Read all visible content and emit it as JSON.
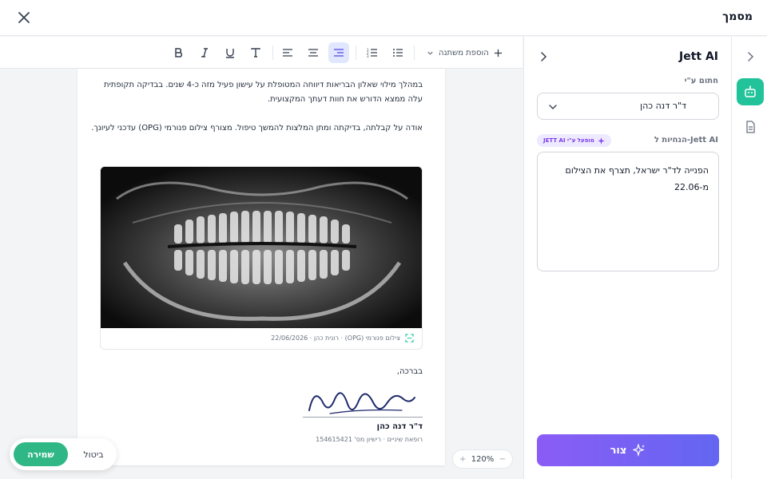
{
  "header": {
    "title": "מסמך"
  },
  "toolbar": {
    "add_variable_label": "הוספת משתנה"
  },
  "document": {
    "paragraph_1": "במהלך מילוי שאלון הבריאות דיווחה המטופלת על עישון פעיל מזה כ-4 שנים. בבדיקה תקופתית עלה ממצא הדורש את חוות דעתך המקצועית.",
    "paragraph_2": "אודה על קבלתה, בדיקתה ומתן המלצות להמשך טיפול. מצורף צילום פנורמי (OPG) עדכני לעיונך.",
    "image_caption": "צילום פנורמי (OPG) · רונית כהן · 22/06/2026",
    "closing": "בברכה,",
    "signer_name": "ד\"ר דנה כהן",
    "signer_details": "רופאת שיניים · רישיון מס' 154615421"
  },
  "zoom": {
    "level": "120%",
    "plus": "+",
    "minus": "−"
  },
  "actions": {
    "save_label": "שמירה",
    "cancel_label": "ביטול"
  },
  "ai_panel": {
    "title": "Jett AI",
    "signed_by_label": "חתום ע\"י",
    "signed_by_value": "ד\"ר דנה כהן",
    "instructions_label": "הנחיות ל-Jett AI",
    "powered_badge": "מופעל ע\"י JETT AI",
    "instructions_text": "הפנייה לד\"ר ישראל, תצרף את הצילום מ-22.06",
    "generate_label": "צור"
  },
  "colors": {
    "accent_green": "#22c39a",
    "save_green": "#2fb886",
    "ai_purple": "#8b5cf6",
    "ai_indigo": "#6366f1"
  }
}
